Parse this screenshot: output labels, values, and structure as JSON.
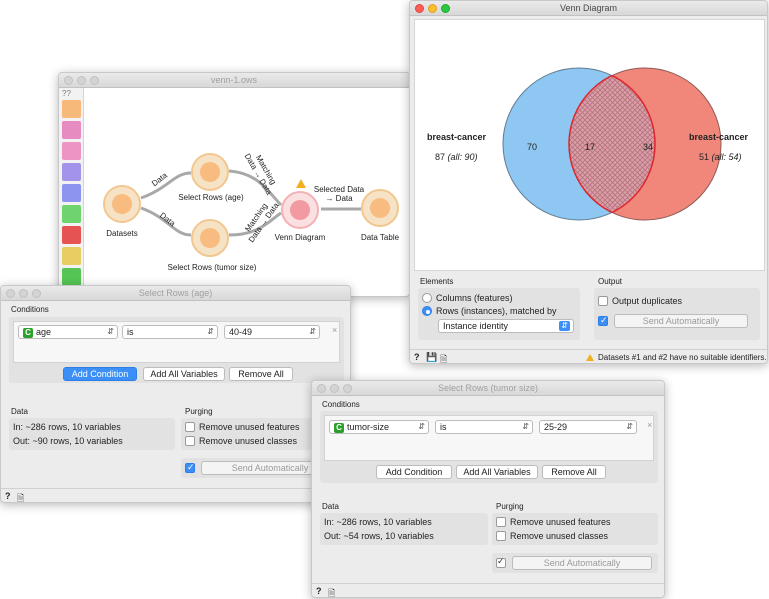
{
  "workflow": {
    "title": "venn-1.ows",
    "sidebar_top": "??",
    "nodes": {
      "datasets": "Datasets",
      "select_age": "Select Rows (age)",
      "select_tumor": "Select Rows (tumor size)",
      "venn": "Venn Diagram",
      "table": "Data Table"
    },
    "links": {
      "data1": "Data",
      "data2": "Data",
      "matching1": "Matching Data → Data",
      "matching2": "Matching Data → Data",
      "selected": "Selected Data → Data"
    }
  },
  "venn": {
    "title": "Venn Diagram",
    "left_name": "breast-cancer",
    "left_count": "87",
    "left_all": "(all: 90)",
    "right_name": "breast-cancer",
    "right_count": "51",
    "right_all": "(all: 54)",
    "only_left": "70",
    "overlap": "17",
    "only_right": "34",
    "colors": {
      "left": "#8ec8f2",
      "right": "#f0877a",
      "overlap_outline": "#e0242c"
    },
    "elements_title": "Elements",
    "opt_columns": "Columns (features)",
    "opt_rows": "Rows (instances), matched by",
    "match_by": "Instance identity",
    "output_title": "Output",
    "output_duplicates": "Output duplicates",
    "send_auto": "Send Automatically",
    "status": "Datasets #1 and #2 have no suitable identifiers."
  },
  "sel_age": {
    "title": "Select Rows (age)",
    "conditions_title": "Conditions",
    "attr": "age",
    "op": "is",
    "value": "40-49",
    "add_condition": "Add Condition",
    "add_all": "Add All Variables",
    "remove_all": "Remove All",
    "data_title": "Data",
    "data_in": "In: ~286 rows, 10 variables",
    "data_out": "Out: ~90 rows, 10 variables",
    "purging_title": "Purging",
    "purge_features": "Remove unused features",
    "purge_classes": "Remove unused classes",
    "send_auto": "Send Automatically"
  },
  "sel_tumor": {
    "title": "Select Rows (tumor size)",
    "conditions_title": "Conditions",
    "attr": "tumor-size",
    "op": "is",
    "value": "25-29",
    "add_condition": "Add Condition",
    "add_all": "Add All Variables",
    "remove_all": "Remove All",
    "data_title": "Data",
    "data_in": "In: ~286 rows, 10 variables",
    "data_out": "Out: ~54 rows, 10 variables",
    "purging_title": "Purging",
    "purge_features": "Remove unused features",
    "purge_classes": "Remove unused classes",
    "send_auto": "Send Automatically"
  }
}
